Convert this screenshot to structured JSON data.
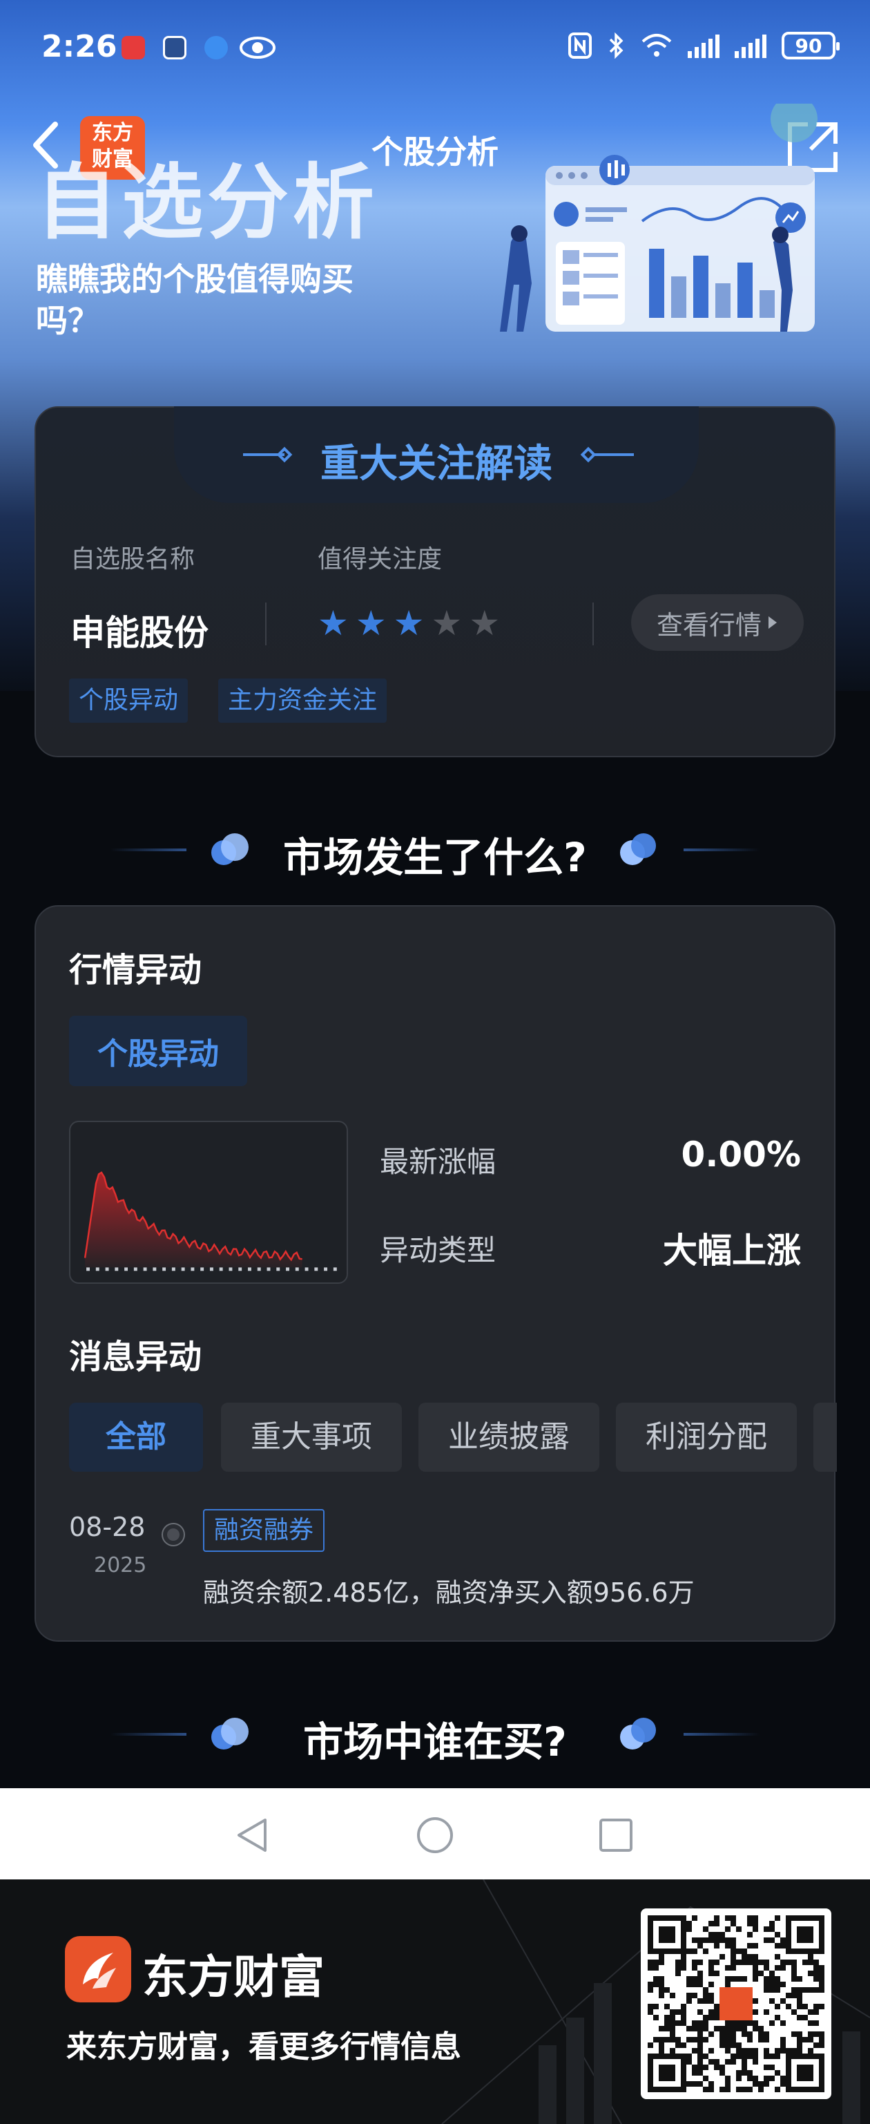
{
  "status_bar": {
    "time": "2:26",
    "battery": "90",
    "icons": [
      "nfc-icon",
      "bluetooth-icon",
      "wifi-icon",
      "signal-icon",
      "signal-icon",
      "battery-icon"
    ]
  },
  "header": {
    "logo_text_line1": "东方",
    "logo_text_line2": "财富",
    "title": "个股分析"
  },
  "hero": {
    "headline": "自选分析",
    "subline": "瞧瞧我的个股值得购买吗？"
  },
  "focus_card": {
    "title": "重大关注解读",
    "name_label": "自选股名称",
    "attention_label": "值得关注度",
    "stock_name": "申能股份",
    "rating": 3,
    "rating_max": 5,
    "view_button": "查看行情",
    "tags": [
      "个股异动",
      "主力资金关注"
    ]
  },
  "section_market": {
    "title": "市场发生了什么?"
  },
  "market_card": {
    "quote_title": "行情异动",
    "active_pill": "个股异动",
    "latest_change_label": "最新涨幅",
    "latest_change_value": "0.00%",
    "type_label": "异动类型",
    "type_value": "大幅上涨",
    "news_title": "消息异动",
    "filters": [
      "全部",
      "重大事项",
      "业绩披露",
      "利润分配"
    ],
    "active_filter": "全部",
    "news": [
      {
        "date": "08-28",
        "year": "2025",
        "tag": "融资融券",
        "text": "融资余额2.485亿，融资净买入额956.6万"
      }
    ]
  },
  "section_buyers": {
    "title": "市场中谁在买?"
  },
  "footer": {
    "brand": "东方财富",
    "slogan": "来东方财富，看更多行情信息"
  },
  "colors": {
    "accent_blue": "#4d92ee",
    "star_on": "#3b7fe0",
    "card_bg": "#23262c",
    "brand_orange": "#e8532a",
    "chart_red": "#d8262a"
  }
}
